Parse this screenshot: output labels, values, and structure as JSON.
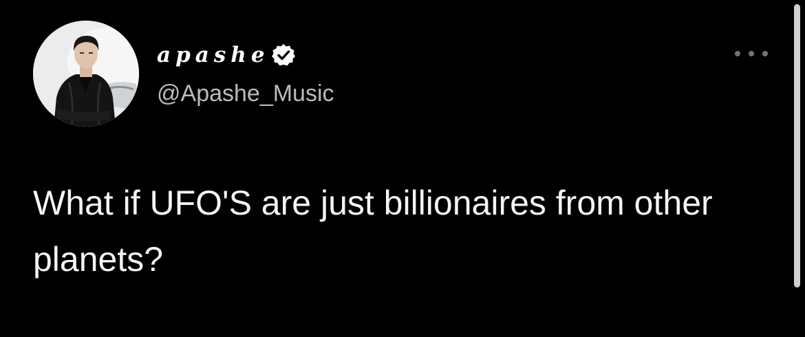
{
  "author": {
    "display_name": "apashe",
    "handle": "@Apashe_Music",
    "verified": true,
    "avatar": "profile-photo"
  },
  "menu": {
    "icon": "more-horizontal-icon"
  },
  "tweet": {
    "text": "What if UFO'S are just billionaires from other planets?"
  },
  "colors": {
    "background": "#000000",
    "text": "#f4f4f4",
    "secondary_text": "#b9bcbf",
    "verified_badge": "#ffffff"
  }
}
